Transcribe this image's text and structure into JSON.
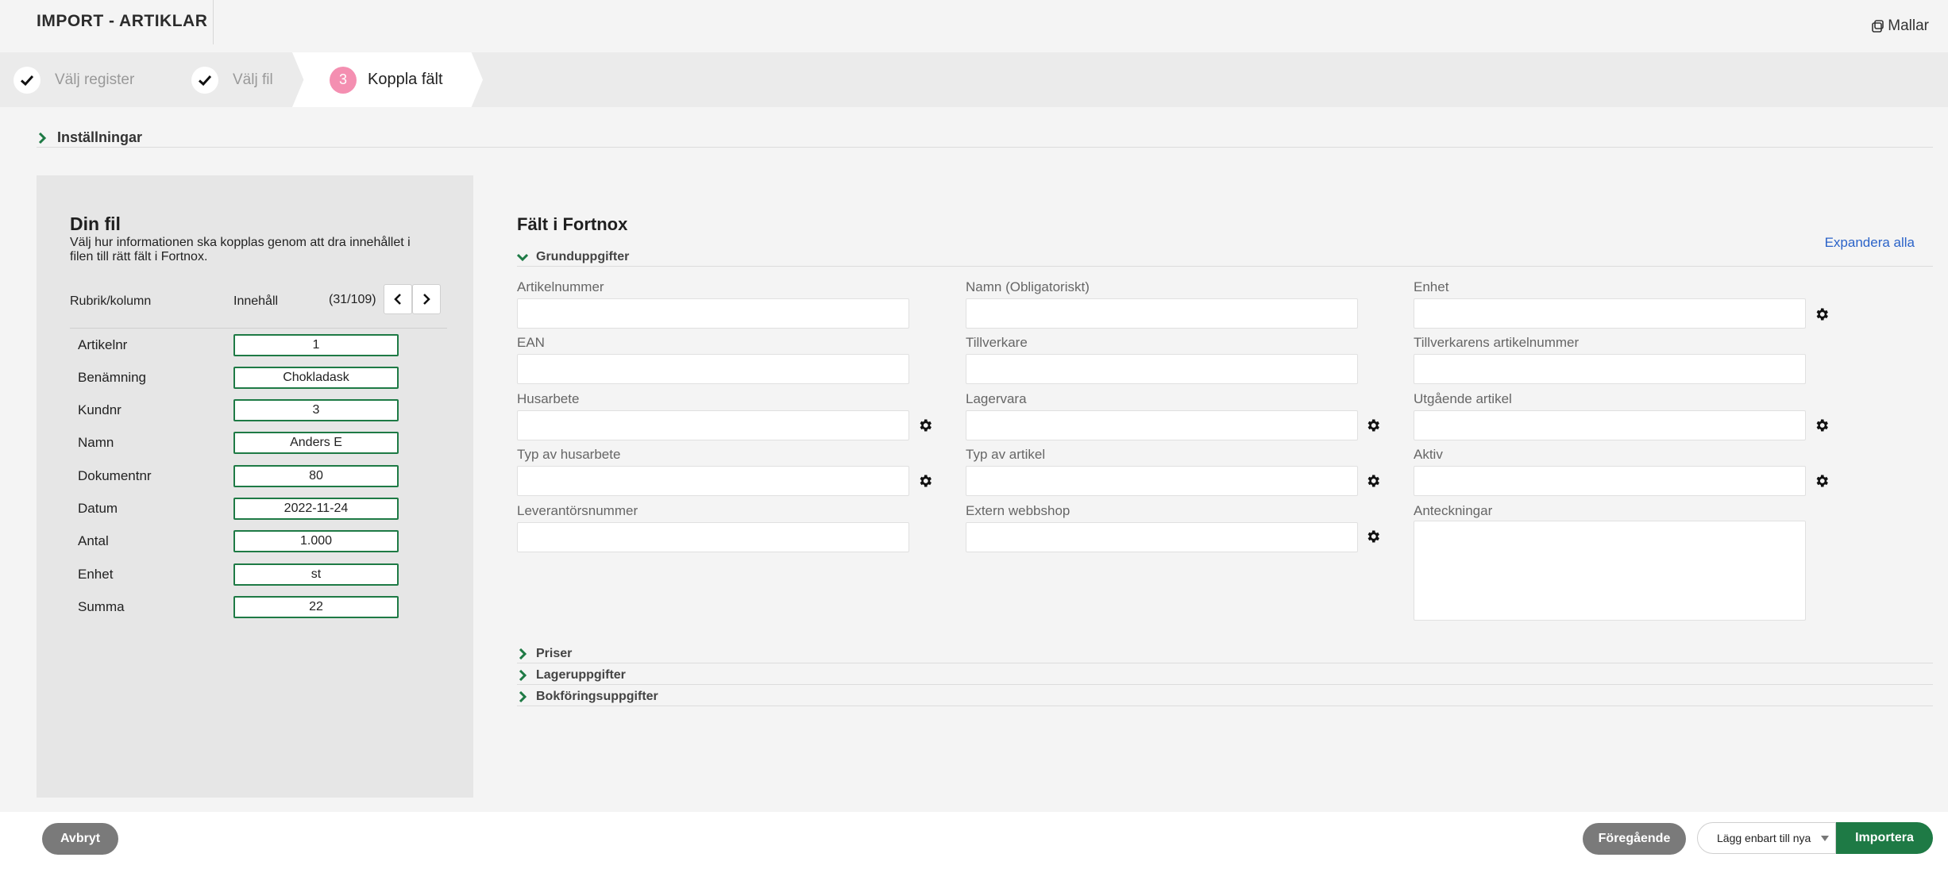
{
  "header": {
    "title": "IMPORT - ARTIKLAR",
    "templates_label": "Mallar"
  },
  "stepper": {
    "steps": [
      {
        "label": "Välj register",
        "state": "done"
      },
      {
        "label": "Välj fil",
        "state": "done"
      },
      {
        "label": "Koppla fält",
        "state": "active",
        "number": "3"
      }
    ]
  },
  "settings": {
    "label": "Inställningar"
  },
  "file_panel": {
    "title": "Din fil",
    "description": "Välj hur informationen ska kopplas genom att dra innehållet i filen till rätt fält i Fortnox.",
    "col_heading": "Rubrik/kolumn",
    "content_heading": "Innehåll",
    "counter": "(31/109)",
    "rows": [
      {
        "label": "Artikelnr",
        "value": "1"
      },
      {
        "label": "Benämning",
        "value": "Chokladask"
      },
      {
        "label": "Kundnr",
        "value": "3"
      },
      {
        "label": "Namn",
        "value": "Anders E"
      },
      {
        "label": "Dokumentnr",
        "value": "80"
      },
      {
        "label": "Datum",
        "value": "2022-11-24"
      },
      {
        "label": "Antal",
        "value": "1.000"
      },
      {
        "label": "Enhet",
        "value": "st"
      },
      {
        "label": "Summa",
        "value": "22"
      }
    ]
  },
  "fortnox": {
    "title": "Fält i Fortnox",
    "expand_all": "Expandera alla",
    "groups": {
      "basic": "Grunduppgifter",
      "prices": "Priser",
      "stock": "Lageruppgifter",
      "accounting": "Bokföringsuppgifter"
    },
    "fields": {
      "artikelnummer": "Artikelnummer",
      "namn": "Namn (Obligatoriskt)",
      "enhet": "Enhet",
      "ean": "EAN",
      "tillverkare": "Tillverkare",
      "tillverkarens_artikelnummer": "Tillverkarens artikelnummer",
      "husarbete": "Husarbete",
      "lagervara": "Lagervara",
      "utgaende_artikel": "Utgående artikel",
      "typ_av_husarbete": "Typ av husarbete",
      "typ_av_artikel": "Typ av artikel",
      "aktiv": "Aktiv",
      "leverantorsnummer": "Leverantörsnummer",
      "extern_webbshop": "Extern webbshop",
      "anteckningar": "Anteckningar"
    }
  },
  "footer": {
    "cancel": "Avbryt",
    "previous": "Föregående",
    "mode_select": "Lägg enbart till nya",
    "import": "Importera"
  },
  "colors": {
    "accent_green": "#1e7a45",
    "step_active_badge": "#f48fb1",
    "link_blue": "#2b63c8"
  }
}
